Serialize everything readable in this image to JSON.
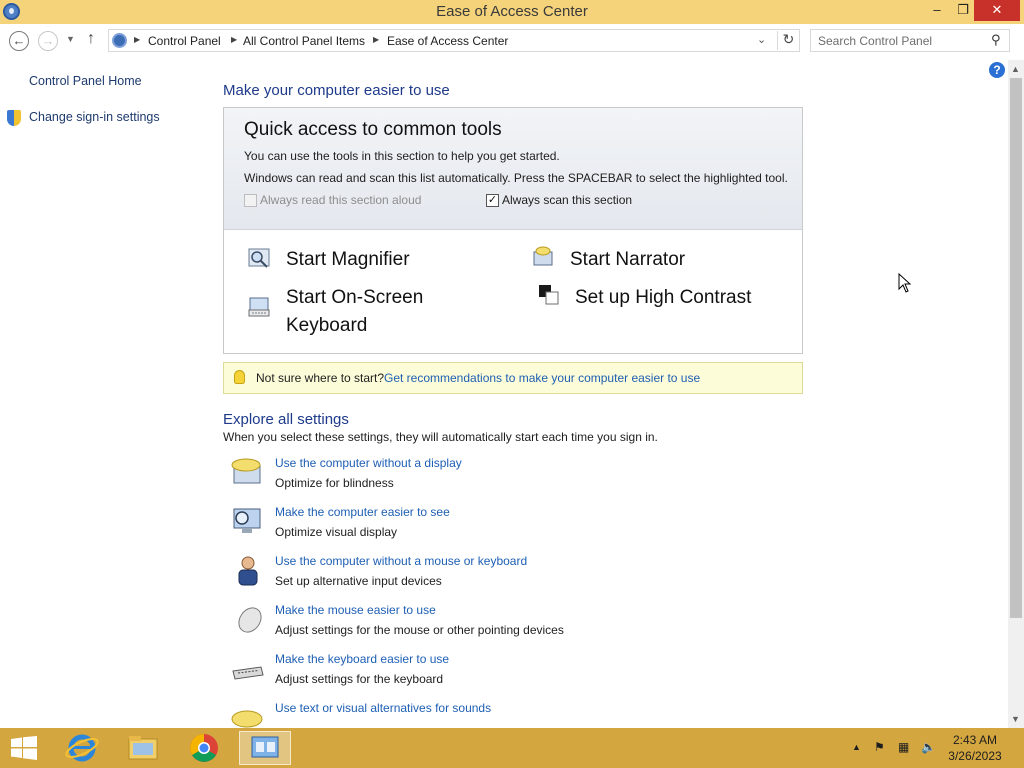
{
  "window": {
    "title": "Ease of Access Center",
    "controls": {
      "minimize": "–",
      "maximize": "❐",
      "close": "✕"
    }
  },
  "address": {
    "breadcrumbs": [
      "Control Panel",
      "All Control Panel Items",
      "Ease of Access Center"
    ],
    "search_placeholder": "Search Control Panel"
  },
  "sidebar": {
    "home": "Control Panel Home",
    "signin": "Change sign-in settings"
  },
  "main": {
    "heading": "Make your computer easier to use",
    "quick": {
      "title": "Quick access to common tools",
      "line1": "You can use the tools in this section to help you get started.",
      "line2": "Windows can read and scan this list automatically.  Press the SPACEBAR to select the highlighted tool.",
      "read_aloud": {
        "label": "Always read this section aloud",
        "checked": false,
        "enabled": false
      },
      "scan": {
        "label": "Always scan this section",
        "checked": true,
        "enabled": true
      },
      "tools": {
        "magnifier": "Start Magnifier",
        "narrator": "Start Narrator",
        "osk_line1": "Start On-Screen",
        "osk_line2": "Keyboard",
        "contrast": "Set up High Contrast"
      }
    },
    "tip": {
      "prefix": "Not sure where to start?",
      "link": "Get recommendations to make your computer easier to use"
    },
    "explore": {
      "heading": "Explore all settings",
      "desc": "When you select these settings, they will automatically start each time you sign in.",
      "items": [
        {
          "link": "Use the computer without a display",
          "desc": "Optimize for blindness"
        },
        {
          "link": "Make the computer easier to see",
          "desc": "Optimize visual display"
        },
        {
          "link": "Use the computer without a mouse or keyboard",
          "desc": "Set up alternative input devices"
        },
        {
          "link": "Make the mouse easier to use",
          "desc": "Adjust settings for the mouse or other pointing devices"
        },
        {
          "link": "Make the keyboard easier to use",
          "desc": "Adjust settings for the keyboard"
        },
        {
          "link": "Use text or visual alternatives for sounds",
          "desc": ""
        }
      ]
    }
  },
  "taskbar": {
    "time": "2:43 AM",
    "date": "3/26/2023"
  },
  "colors": {
    "titlebar": "#f5d37a",
    "taskbar": "#d4a63f",
    "link": "#1e5fb4",
    "heading": "#1e3a8a"
  }
}
